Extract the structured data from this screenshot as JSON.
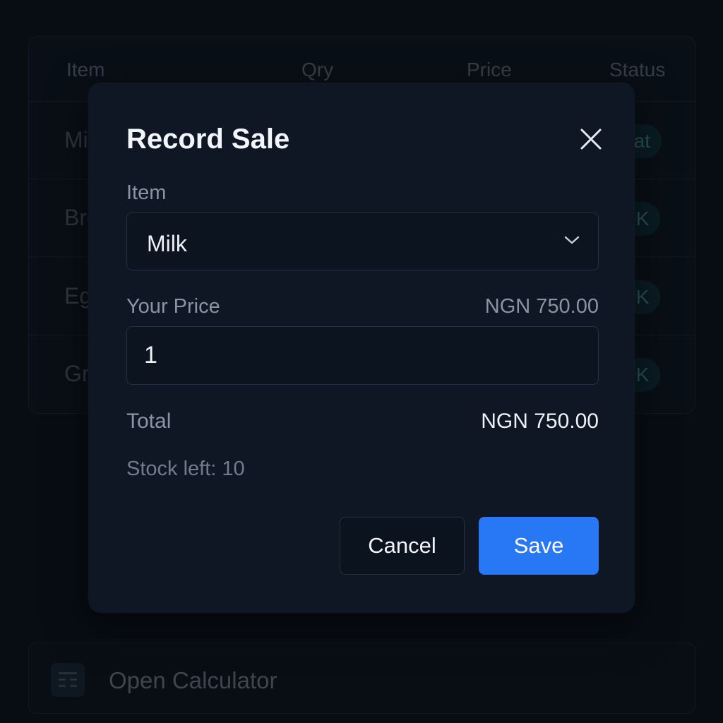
{
  "table": {
    "headers": [
      "Item",
      "Qry",
      "Price",
      "Status"
    ],
    "rows": [
      {
        "item": "Milk",
        "status": "Eat"
      },
      {
        "item": "Bread",
        "status": "OK"
      },
      {
        "item": "Eggs",
        "status": "OK"
      },
      {
        "item": "Grapes",
        "status": "OK"
      }
    ]
  },
  "modal": {
    "title": "Record Sale",
    "item_label": "Item",
    "item_selected": "Milk",
    "price_label": "Your Price",
    "price_value": "NGN 750.00",
    "quantity_value": "1",
    "total_label": "Total",
    "total_value": "NGN 750.00",
    "stock_text": "Stock left: 10",
    "cancel_label": "Cancel",
    "save_label": "Save"
  },
  "calculator": {
    "label": "Open Calculator",
    "icon": "calculator-icon"
  },
  "icons": {
    "close": "close-icon",
    "dropdown": "chevron-down-icon"
  },
  "colors": {
    "background": "#0a1019",
    "modal": "#0e1723",
    "accent": "#2877f5",
    "status_pill": "#0e2a33"
  }
}
